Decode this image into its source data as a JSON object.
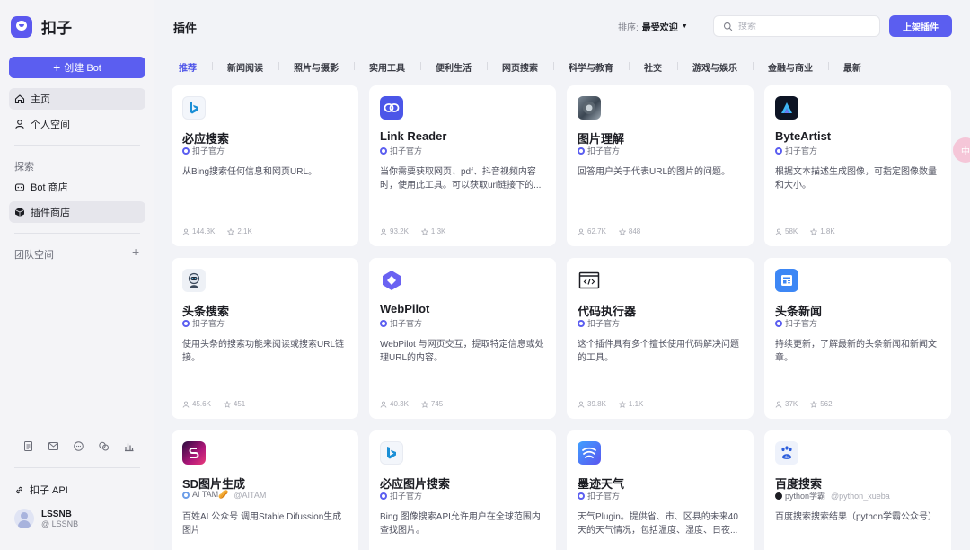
{
  "sidebar": {
    "logo_text": "扣子",
    "create_label": "创建 Bot",
    "nav": {
      "home": "主页",
      "personal": "个人空间"
    },
    "explore_label": "探索",
    "explore_items": {
      "bot_store": "Bot 商店",
      "plugin_store": "插件商店"
    },
    "team_label": "团队空间",
    "api_label": "扣子 API",
    "user": {
      "name": "LSSNB",
      "handle": "@ LSSNB"
    }
  },
  "header": {
    "title": "插件",
    "sort_label": "排序:",
    "sort_value": "最受欢迎",
    "search_placeholder": "搜索",
    "publish_label": "上架插件"
  },
  "tabs": [
    "推荐",
    "新闻阅读",
    "照片与摄影",
    "实用工具",
    "便利生活",
    "网页搜索",
    "科学与教育",
    "社交",
    "游戏与娱乐",
    "金融与商业",
    "最新"
  ],
  "cards": [
    {
      "title": "必应搜索",
      "author": "扣子官方",
      "desc": "从Bing搜索任何信息和网页URL。",
      "users": "144.3K",
      "stars": "2.1K"
    },
    {
      "title": "Link Reader",
      "author": "扣子官方",
      "desc": "当你需要获取网页、pdf、抖音视频内容时，使用此工具。可以获取url链接下的...",
      "users": "93.2K",
      "stars": "1.3K"
    },
    {
      "title": "图片理解",
      "author": "扣子官方",
      "desc": "回答用户关于代表URL的图片的问题。",
      "users": "62.7K",
      "stars": "848"
    },
    {
      "title": "ByteArtist",
      "author": "扣子官方",
      "desc": "根据文本描述生成图像，可指定图像数量和大小。",
      "users": "58K",
      "stars": "1.8K"
    },
    {
      "title": "头条搜索",
      "author": "扣子官方",
      "desc": "使用头条的搜索功能来阅读或搜索URL链接。",
      "users": "45.6K",
      "stars": "451"
    },
    {
      "title": "WebPilot",
      "author": "扣子官方",
      "desc": "WebPilot 与网页交互，提取特定信息或处理URL的内容。",
      "users": "40.3K",
      "stars": "745"
    },
    {
      "title": "代码执行器",
      "author": "扣子官方",
      "desc": "这个插件具有多个擅长使用代码解决问题的工具。",
      "users": "39.8K",
      "stars": "1.1K"
    },
    {
      "title": "头条新闻",
      "author": "扣子官方",
      "desc": "持续更新，了解最新的头条新闻和新闻文章。",
      "users": "37K",
      "stars": "562"
    },
    {
      "title": "SD图片生成",
      "author": "AI TAM🥜",
      "handle": "@AITAM",
      "desc": "百姓AI 公众号 调用Stable Difussion生成图片",
      "users": "",
      "stars": ""
    },
    {
      "title": "必应图片搜索",
      "author": "扣子官方",
      "desc": "Bing 图像搜索API允许用户在全球范围内查找图片。",
      "users": "",
      "stars": ""
    },
    {
      "title": "墨迹天气",
      "author": "扣子官方",
      "desc": "天气Plugin。提供省、市、区县的未来40天的天气情况，包括温度、湿度、日夜...",
      "users": "",
      "stars": ""
    },
    {
      "title": "百度搜索",
      "author": "python学霸",
      "handle": "@python_xueba",
      "desc": "百度搜索搜索结果（python学霸公众号）",
      "users": "",
      "stars": ""
    }
  ]
}
